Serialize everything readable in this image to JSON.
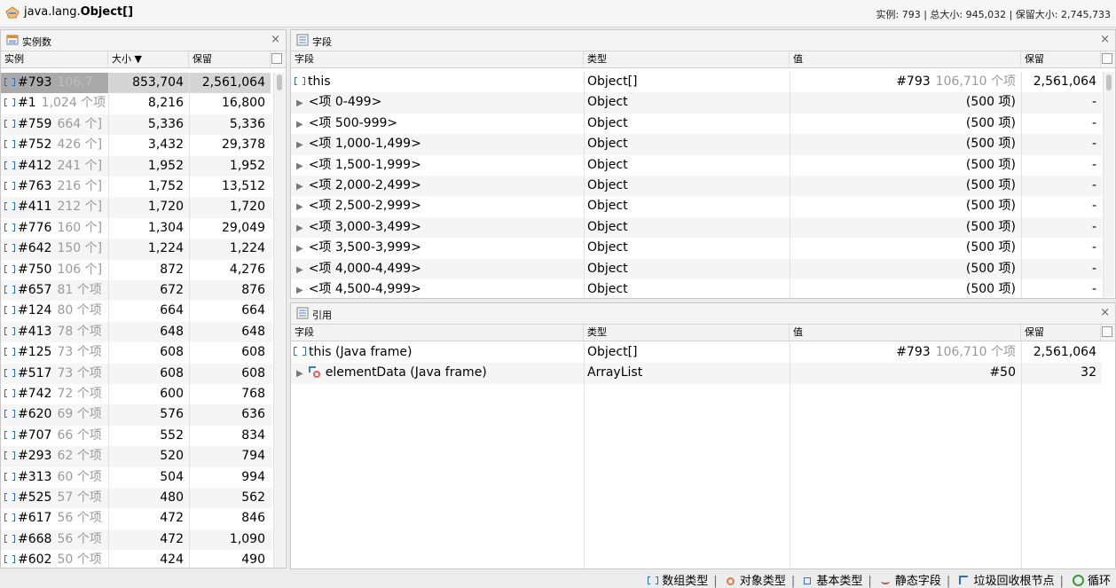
{
  "header": {
    "class_name_prefix": "java.lang.",
    "class_name_bold": "Object[]",
    "stats": "实例: 793 | 总大小: 945,032 | 保留大小: 2,745,733"
  },
  "instances_panel": {
    "title": "实例数",
    "close": "×",
    "columns": {
      "instance": "实例",
      "size": "大小 ▼",
      "retained": "保留"
    },
    "rows": [
      {
        "id": "#793",
        "count": "106,7",
        "size": "853,704",
        "retained": "2,561,064",
        "selected": true
      },
      {
        "id": "#1",
        "count": "1,024 个项",
        "size": "8,216",
        "retained": "16,800"
      },
      {
        "id": "#759",
        "count": "664 个]",
        "size": "5,336",
        "retained": "5,336"
      },
      {
        "id": "#752",
        "count": "426 个]",
        "size": "3,432",
        "retained": "29,378"
      },
      {
        "id": "#412",
        "count": "241 个]",
        "size": "1,952",
        "retained": "1,952"
      },
      {
        "id": "#763",
        "count": "216 个]",
        "size": "1,752",
        "retained": "13,512"
      },
      {
        "id": "#411",
        "count": "212 个]",
        "size": "1,720",
        "retained": "1,720"
      },
      {
        "id": "#776",
        "count": "160 个]",
        "size": "1,304",
        "retained": "29,049"
      },
      {
        "id": "#642",
        "count": "150 个]",
        "size": "1,224",
        "retained": "1,224"
      },
      {
        "id": "#750",
        "count": "106 个]",
        "size": "872",
        "retained": "4,276"
      },
      {
        "id": "#657",
        "count": "81 个项",
        "size": "672",
        "retained": "876"
      },
      {
        "id": "#124",
        "count": "80 个项",
        "size": "664",
        "retained": "664"
      },
      {
        "id": "#413",
        "count": "78 个项",
        "size": "648",
        "retained": "648"
      },
      {
        "id": "#125",
        "count": "73 个项",
        "size": "608",
        "retained": "608"
      },
      {
        "id": "#517",
        "count": "73 个项",
        "size": "608",
        "retained": "608"
      },
      {
        "id": "#742",
        "count": "72 个项",
        "size": "600",
        "retained": "768"
      },
      {
        "id": "#620",
        "count": "69 个项",
        "size": "576",
        "retained": "636"
      },
      {
        "id": "#707",
        "count": "66 个项",
        "size": "552",
        "retained": "834"
      },
      {
        "id": "#293",
        "count": "62 个项",
        "size": "520",
        "retained": "794"
      },
      {
        "id": "#313",
        "count": "60 个项",
        "size": "504",
        "retained": "994"
      },
      {
        "id": "#525",
        "count": "57 个项",
        "size": "480",
        "retained": "562"
      },
      {
        "id": "#617",
        "count": "56 个项",
        "size": "472",
        "retained": "846"
      },
      {
        "id": "#668",
        "count": "56 个项",
        "size": "472",
        "retained": "1,090"
      },
      {
        "id": "#602",
        "count": "50 个项",
        "size": "424",
        "retained": "490"
      }
    ]
  },
  "fields_panel": {
    "title": "字段",
    "close": "×",
    "columns": {
      "field": "字段",
      "type": "类型",
      "value": "值",
      "retained": "保留"
    },
    "this_row": {
      "name": "this",
      "type": "Object[]",
      "value_id": "#793",
      "value_count": "106,710 个项",
      "retained": "2,561,064"
    },
    "rows": [
      {
        "name": "<项 0-499>",
        "type": "Object",
        "value": "(500 项)",
        "retained": "-"
      },
      {
        "name": "<项 500-999>",
        "type": "Object",
        "value": "(500 项)",
        "retained": "-"
      },
      {
        "name": "<项 1,000-1,499>",
        "type": "Object",
        "value": "(500 项)",
        "retained": "-"
      },
      {
        "name": "<项 1,500-1,999>",
        "type": "Object",
        "value": "(500 项)",
        "retained": "-"
      },
      {
        "name": "<项 2,000-2,499>",
        "type": "Object",
        "value": "(500 项)",
        "retained": "-"
      },
      {
        "name": "<项 2,500-2,999>",
        "type": "Object",
        "value": "(500 项)",
        "retained": "-"
      },
      {
        "name": "<项 3,000-3,499>",
        "type": "Object",
        "value": "(500 项)",
        "retained": "-"
      },
      {
        "name": "<项 3,500-3,999>",
        "type": "Object",
        "value": "(500 项)",
        "retained": "-"
      },
      {
        "name": "<项 4,000-4,499>",
        "type": "Object",
        "value": "(500 项)",
        "retained": "-"
      },
      {
        "name": "<项 4,500-4,999>",
        "type": "Object",
        "value": "(500 项)",
        "retained": "-"
      }
    ]
  },
  "references_panel": {
    "title": "引用",
    "close": "×",
    "columns": {
      "field": "字段",
      "type": "类型",
      "value": "值",
      "retained": "保留"
    },
    "this_row": {
      "name": "this (Java frame)",
      "type": "Object[]",
      "value_id": "#793",
      "value_count": "106,710 个项",
      "retained": "2,561,064"
    },
    "rows": [
      {
        "name": "elementData (Java frame)",
        "type": "ArrayList",
        "value": "#50",
        "retained": "32"
      }
    ]
  },
  "legend": {
    "array": "数组类型",
    "object": "对象类型",
    "primitive": "基本类型",
    "static": "静态字段",
    "gc_root": "垃圾回收根节点",
    "loop": "循环"
  }
}
